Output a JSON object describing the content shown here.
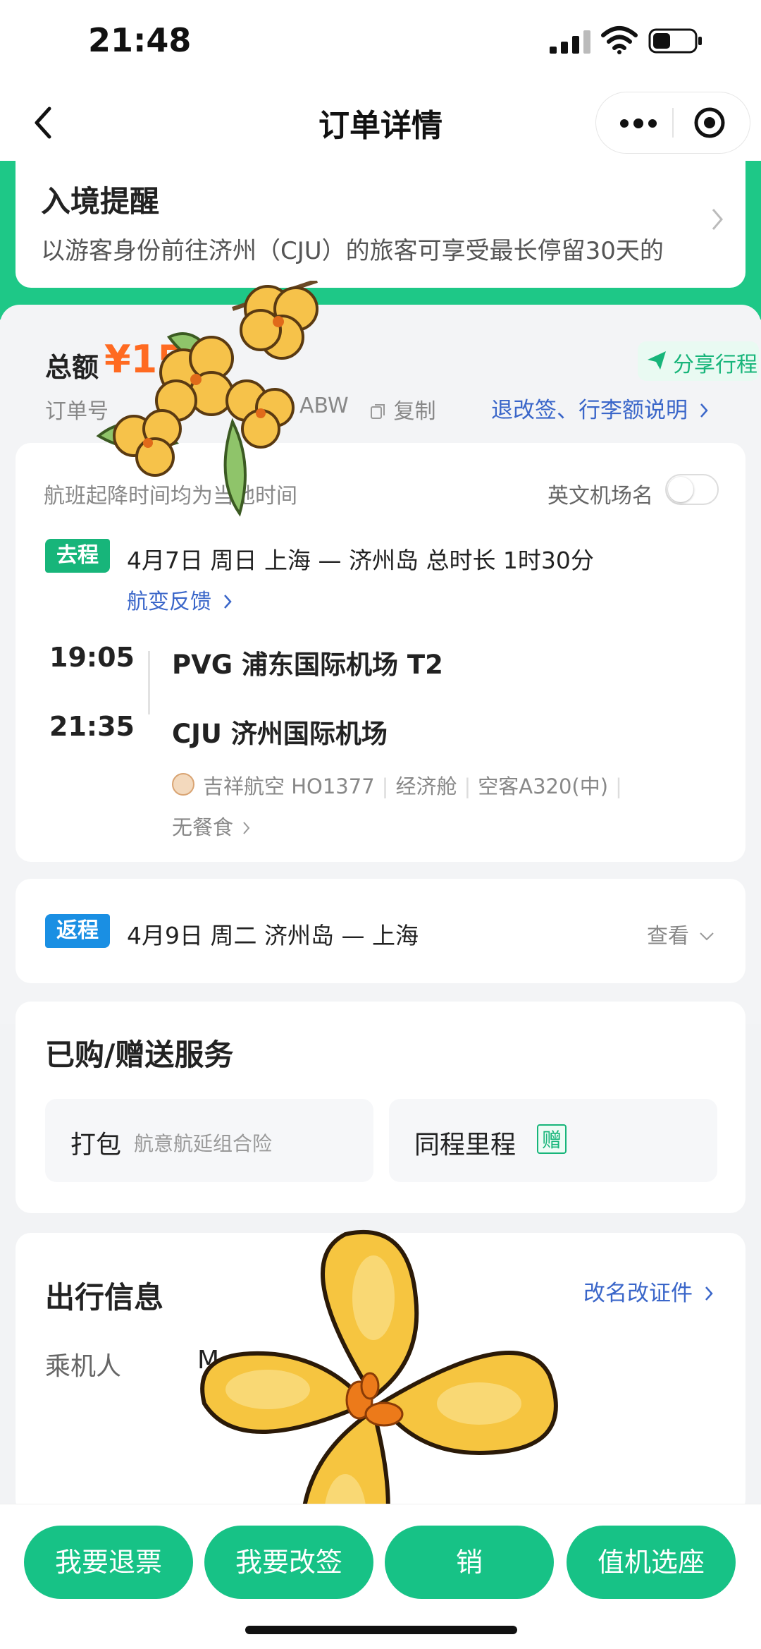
{
  "status": {
    "time": "21:48"
  },
  "nav": {
    "title": "订单详情"
  },
  "reminder": {
    "title": "入境提醒",
    "text": "以游客身份前往济州（CJU）的旅客可享受最长停留30天的"
  },
  "order": {
    "total_label": "总额",
    "total_value": "¥15",
    "share_label": "分享行程",
    "order_no_label": "订单号",
    "order_code_fragment": "ABW",
    "copy_label": "复制",
    "refund_link": "退改签、行李额说明"
  },
  "flight": {
    "tz_note": "航班起降时间均为当地时间",
    "english_name_label": "英文机场名",
    "english_name_on": false,
    "outbound": {
      "tag": "去程",
      "summary": "4月7日 周日 上海 — 济州岛 总时长 1时30分",
      "feedback": "航变反馈",
      "dep_time": "19:05",
      "arr_time": "21:35",
      "dep_airport": "PVG 浦东国际机场 T2",
      "arr_airport": "CJU 济州国际机场",
      "airline": "吉祥航空 HO1377",
      "cabin": "经济舱",
      "aircraft": "空客A320(中)",
      "meal": "无餐食"
    },
    "return": {
      "tag": "返程",
      "summary": "4月9日 周二 济州岛 — 上海",
      "view": "查看"
    }
  },
  "services": {
    "title": "已购/赠送服务",
    "items": [
      {
        "name": "打包",
        "sub": "航意航延组合险"
      },
      {
        "name": "同程里程",
        "badge": "赠"
      }
    ]
  },
  "trip": {
    "title": "出行信息",
    "rename_link": "改名改证件",
    "passenger_label": "乘机人",
    "passenger_value": "M"
  },
  "actions": {
    "refund": "我要退票",
    "change": "我要改签",
    "reimburse": "销",
    "checkin": "值机选座"
  },
  "colors": {
    "brand_green": "#17c286",
    "link_blue": "#3a66c9",
    "price_orange": "#ff6a21",
    "return_blue": "#1a8fe3"
  }
}
